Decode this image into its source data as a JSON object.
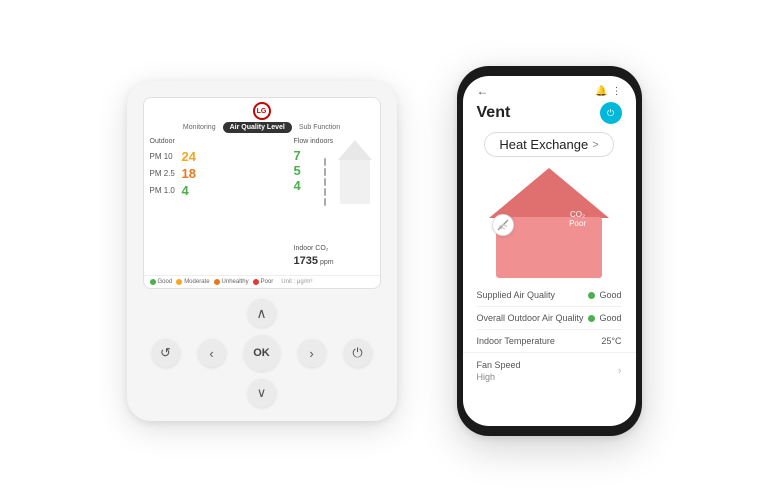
{
  "scene": {
    "bg": "#ffffff"
  },
  "lg_device": {
    "logo_text": "LG",
    "tabs": [
      {
        "id": "monitoring",
        "label": "Monitoring",
        "active": false
      },
      {
        "id": "air_quality",
        "label": "Air Quality Level",
        "active": true
      },
      {
        "id": "sub_function",
        "label": "Sub Function",
        "active": false
      }
    ],
    "outdoor_label": "Outdoor",
    "flow_label": "Flow indoors",
    "pm_rows": [
      {
        "label": "PM 10",
        "value": "24",
        "color_class": "pm-val-yellow"
      },
      {
        "label": "PM 2.5",
        "value": "18",
        "color_class": "pm-val-orange"
      },
      {
        "label": "PM 1.0",
        "value": "4",
        "color_class": "pm-val-green"
      }
    ],
    "flow_values": [
      "7",
      "5",
      "4"
    ],
    "indoor_co2_label": "Indoor CO₂",
    "co2_value": "1735",
    "co2_unit": "ppm",
    "legend": [
      {
        "label": "Good",
        "color": "#4caf50"
      },
      {
        "label": "Moderate",
        "color": "#f5a623"
      },
      {
        "label": "Unhealthy",
        "color": "#e87722"
      },
      {
        "label": "Poor",
        "color": "#e53935"
      }
    ],
    "unit_label": "Unit : μg/m³",
    "controls": {
      "up": "∧",
      "down": "∨",
      "left": "‹",
      "right": "›",
      "ok": "OK",
      "back": "↺",
      "power": "⏻"
    }
  },
  "phone": {
    "back_icon": "←",
    "bell_icon": "🔔",
    "more_icon": "⋮",
    "title": "Vent",
    "power_icon": "⏻",
    "heat_exchange_label": "Heat Exchange",
    "heat_chevron": ">",
    "house": {
      "co2_label": "CO₂",
      "co2_status": "Poor"
    },
    "info_rows": [
      {
        "label": "Supplied Air Quality",
        "status": "Good",
        "show_dot": true
      },
      {
        "label": "Overall Outdoor Air Quality",
        "status": "Good",
        "show_dot": true
      },
      {
        "label": "Indoor Temperature",
        "value": "25°C",
        "show_dot": false
      }
    ],
    "fan_speed": {
      "label": "Fan Speed",
      "value": "High",
      "chevron": "›"
    }
  }
}
